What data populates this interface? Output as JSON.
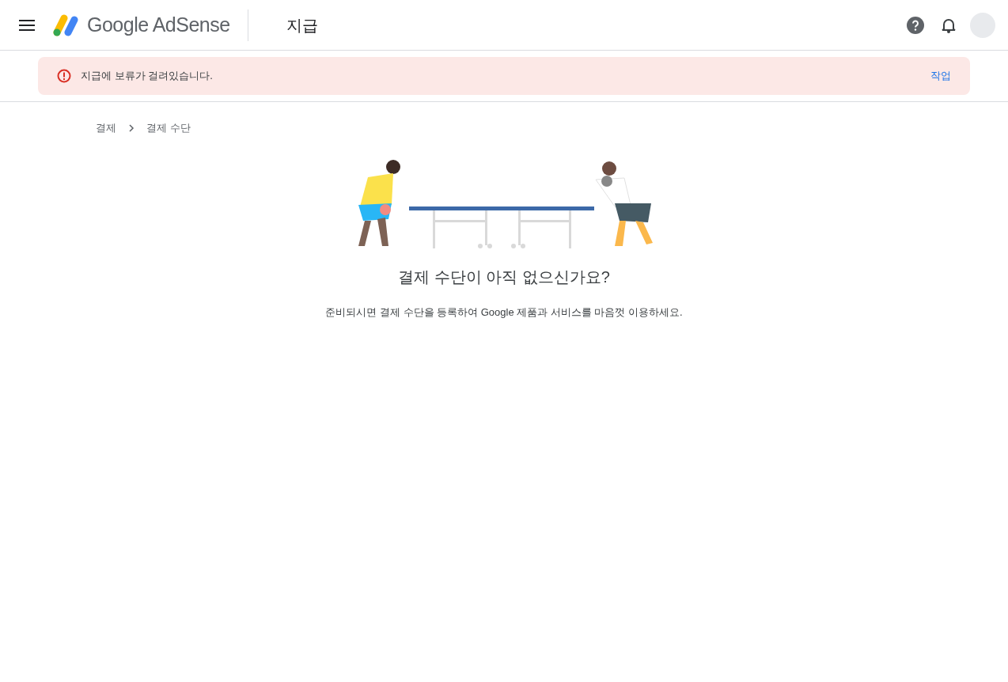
{
  "header": {
    "brand": "Google AdSense",
    "page_title": "지급"
  },
  "alert": {
    "message": "지급에 보류가 걸려있습니다.",
    "action": "작업"
  },
  "breadcrumb": [
    {
      "label": "결제"
    },
    {
      "label": "결제 수단"
    }
  ],
  "empty_state": {
    "title": "결제 수단이 아직 없으신가요?",
    "description": "준비되시면 결제 수단을 등록하여 Google 제품과 서비스를 마음껏 이용하세요."
  }
}
